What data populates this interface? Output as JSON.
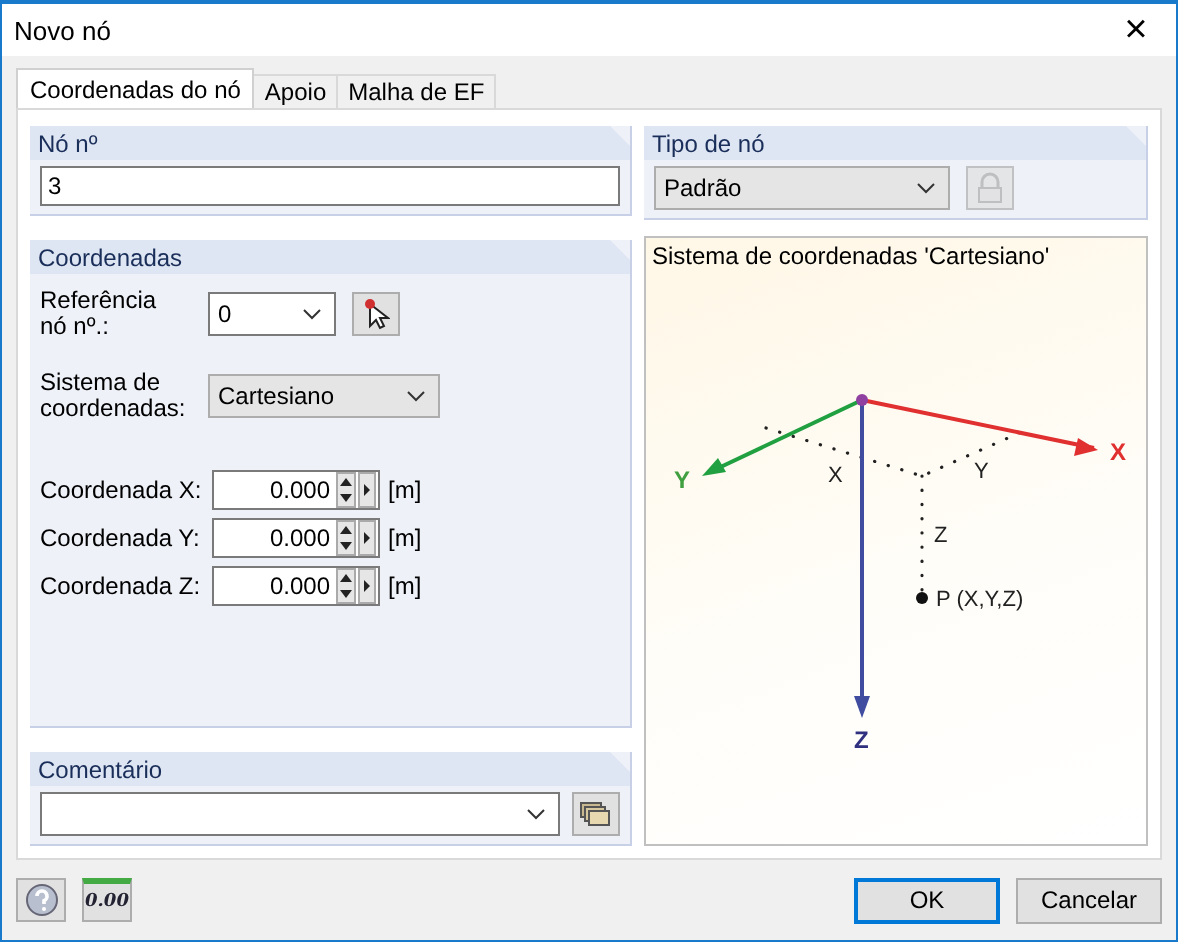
{
  "window": {
    "title": "Novo nó",
    "close": "×"
  },
  "tabs": [
    {
      "label": "Coordenadas do nó",
      "selected": true
    },
    {
      "label": "Apoio",
      "selected": false
    },
    {
      "label": "Malha de EF",
      "selected": false
    }
  ],
  "node_number": {
    "title": "Nó nº",
    "value": "3"
  },
  "coordinates": {
    "title": "Coordenadas",
    "reference_label": "Referência nó nº.:",
    "reference_value": "0",
    "system_label": "Sistema de coordenadas:",
    "system_value": "Cartesiano",
    "rows": [
      {
        "label": "Coordenada X:",
        "value": "0.000",
        "unit": "[m]"
      },
      {
        "label": "Coordenada Y:",
        "value": "0.000",
        "unit": "[m]"
      },
      {
        "label": "Coordenada Z:",
        "value": "0.000",
        "unit": "[m]"
      }
    ]
  },
  "comment": {
    "title": "Comentário"
  },
  "node_type": {
    "title": "Tipo de nó",
    "value": "Padrão"
  },
  "diagram": {
    "title": "Sistema de coordenadas 'Cartesiano'",
    "axis_labels": [
      "X",
      "Y",
      "Z"
    ],
    "component_labels": [
      "X",
      "Y",
      "Z"
    ],
    "point_label": "P (X,Y,Z)"
  },
  "footer": {
    "units_icon_text": "0.00",
    "buttons": [
      "OK",
      "Cancelar"
    ]
  }
}
